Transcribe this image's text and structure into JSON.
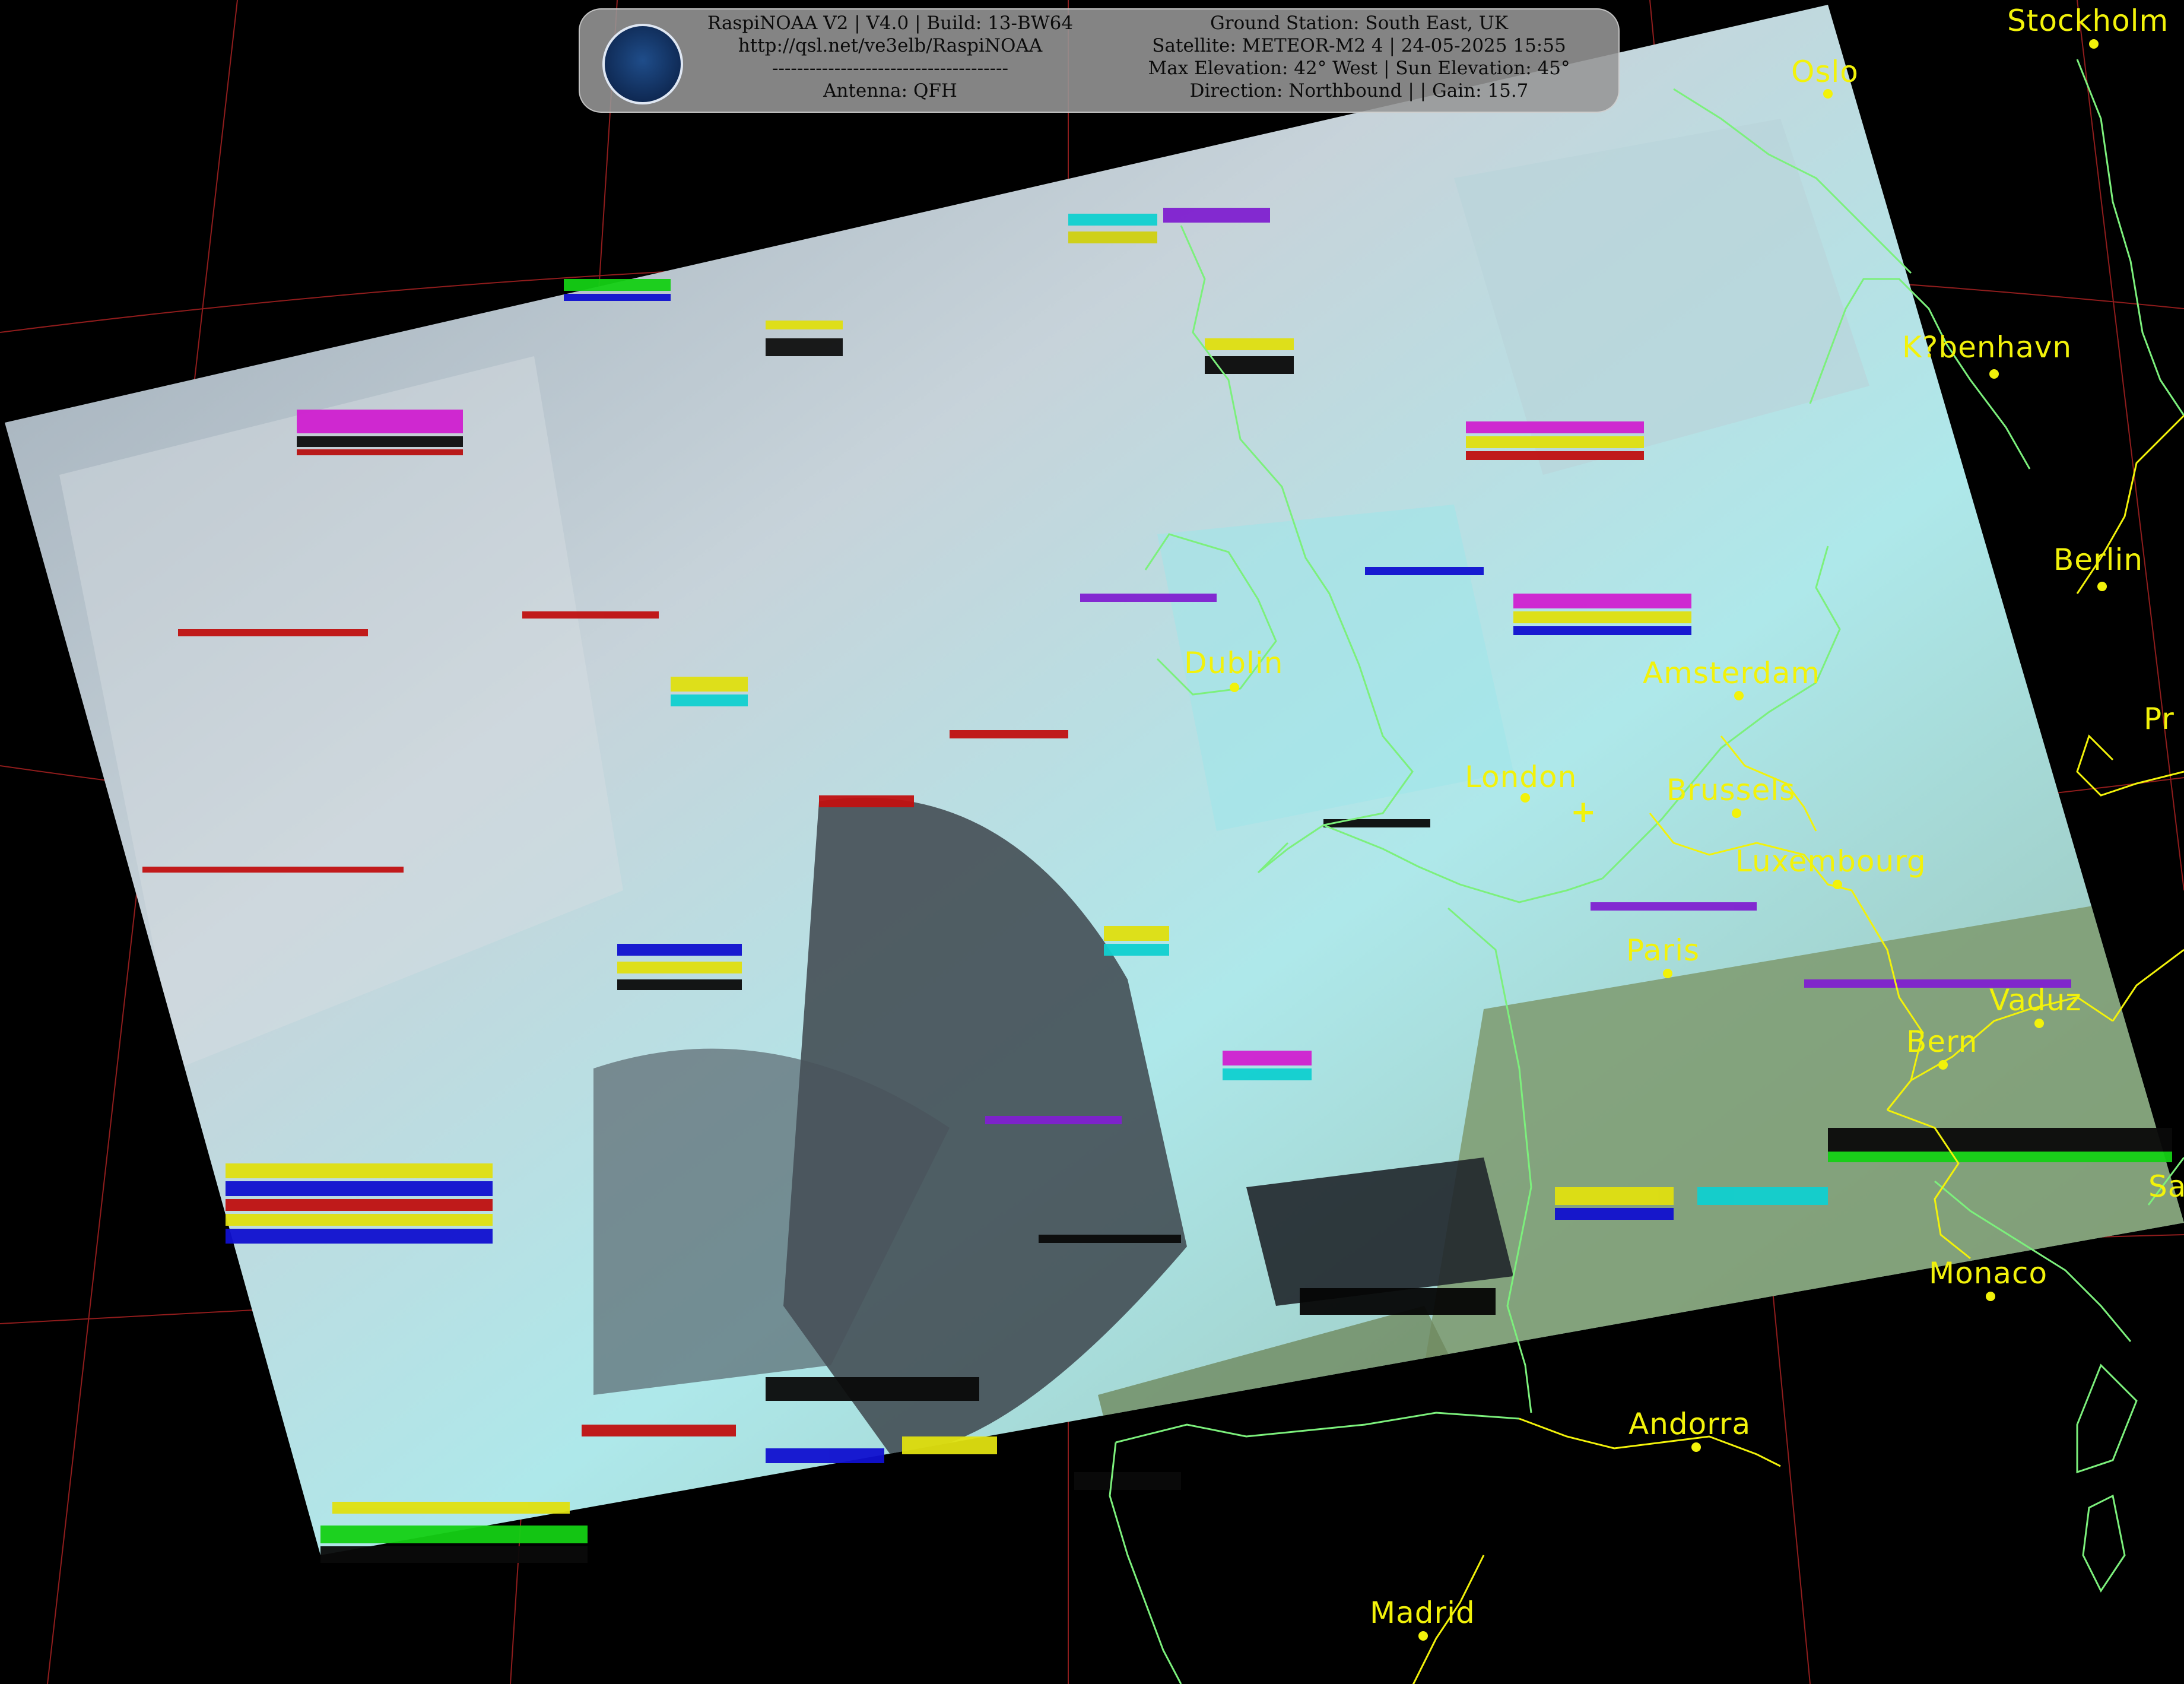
{
  "header": {
    "left_lines": [
      "RaspiNOAA V2 | V4.0 | Build: 13-BW64",
      "http://qsl.net/ve3elb/RaspiNOAA",
      "--------------------------------------",
      "Antenna: QFH"
    ],
    "right_lines": [
      "Ground Station: South East, UK",
      "Satellite: METEOR-M2 4 | 24-05-2025 15:55",
      "Max Elevation: 42° West | Sun Elevation: 45°",
      "Direction: Northbound | | Gain: 15.7"
    ]
  },
  "logo_icon": "satellite-icon",
  "station_marker": "+",
  "cities": [
    {
      "name": "Stockholm"
    },
    {
      "name": "Oslo"
    },
    {
      "name": "K?benhavn"
    },
    {
      "name": "Berlin"
    },
    {
      "name": "Pr"
    },
    {
      "name": "Dublin"
    },
    {
      "name": "Amsterdam"
    },
    {
      "name": "London"
    },
    {
      "name": "Brussels"
    },
    {
      "name": "Luxembourg"
    },
    {
      "name": "Paris"
    },
    {
      "name": "Vaduz"
    },
    {
      "name": "Bern"
    },
    {
      "name": "Sa"
    },
    {
      "name": "Monaco"
    },
    {
      "name": "Andorra"
    },
    {
      "name": "Madrid"
    }
  ],
  "colors": {
    "city_labels": "#f2f20a",
    "coastline": "#7cf07c",
    "borders": "#f2f20a",
    "graticule": "#a02020",
    "background": "#000000"
  }
}
